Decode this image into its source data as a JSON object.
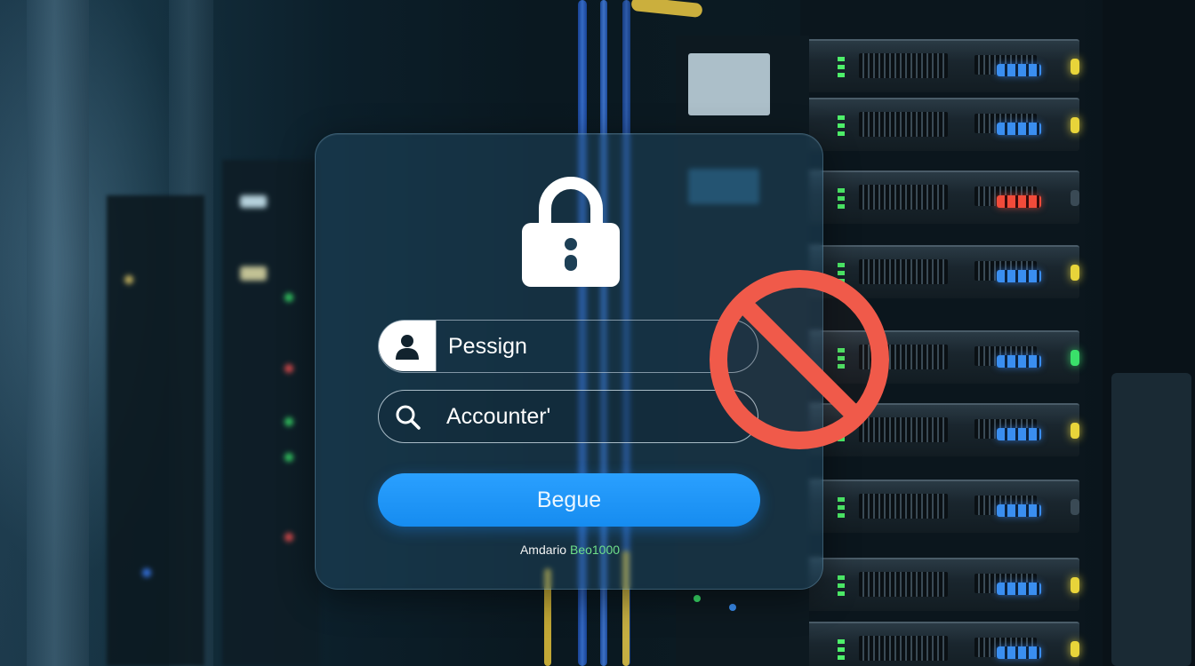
{
  "login": {
    "username_value": "Pessign",
    "account_value": "Accounter'",
    "submit_label": "Begue",
    "footer_text_a": "Amdario",
    "footer_text_b": "Beo1000"
  },
  "icons": {
    "lock": "lock-icon",
    "user": "user-icon",
    "search": "search-icon",
    "prohibited": "prohibited-icon"
  },
  "colors": {
    "button": "#168cf0",
    "prohibited": "#f05a4a",
    "footer_accent": "#6fe08a"
  }
}
